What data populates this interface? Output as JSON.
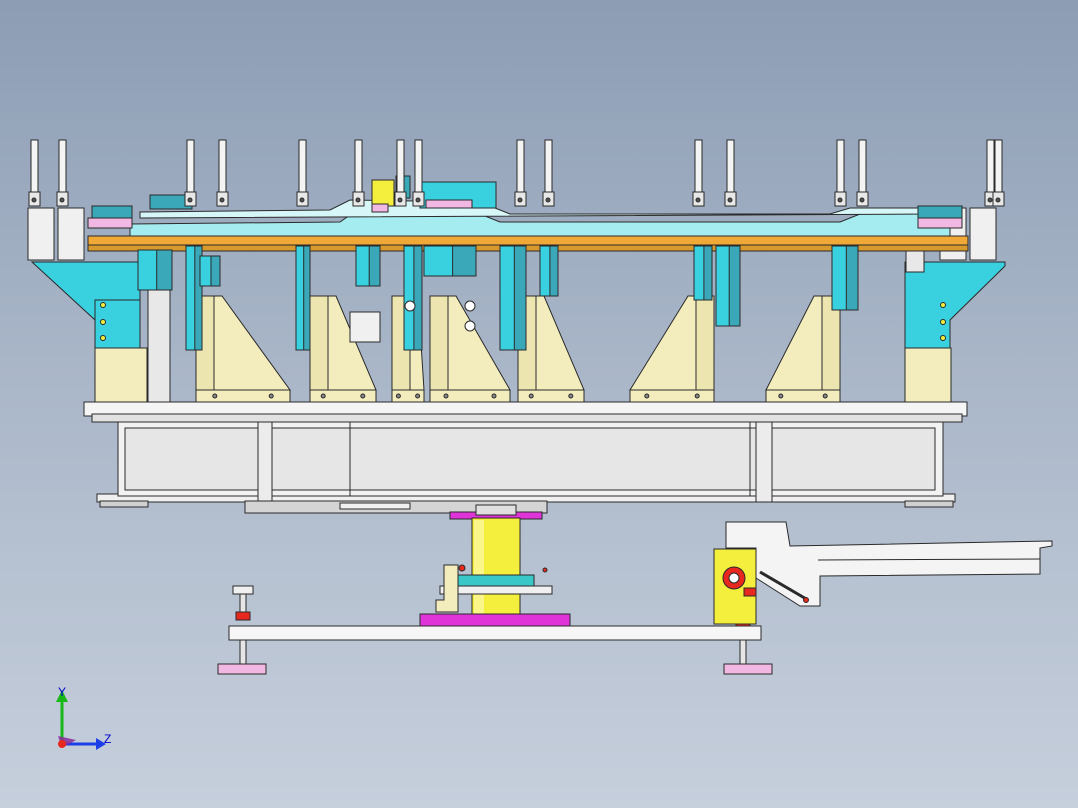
{
  "viewport": {
    "triad": {
      "y_label": "Y",
      "z_label": "Z"
    },
    "colors": {
      "cyan": "#39d0e0",
      "teal": "#3aa8b8",
      "cream": "#f3edbe",
      "orange": "#f0a836",
      "yellow": "#f4ee3c",
      "magenta": "#e033d8",
      "pink": "#f2b8e4",
      "red": "#e8281e",
      "grey": "#d8d8d8",
      "white": "#f6f6f6",
      "outline": "#2a2a2a"
    }
  }
}
